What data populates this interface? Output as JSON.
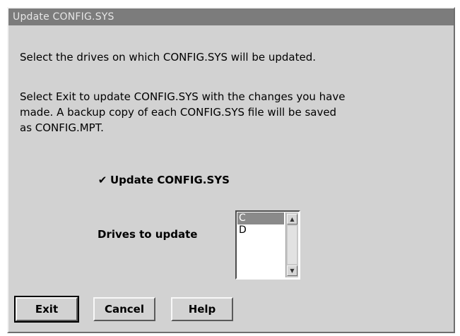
{
  "window": {
    "title": "Update CONFIG.SYS"
  },
  "body": {
    "instruction1": "Select the drives on which CONFIG.SYS will be updated.",
    "instruction2": "Select Exit to update CONFIG.SYS with the changes you have\nmade.  A backup copy of each CONFIG.SYS file will be saved\nas CONFIG.MPT."
  },
  "checkbox": {
    "label": "Update CONFIG.SYS",
    "checked": true,
    "mark": "✔"
  },
  "drives": {
    "label": "Drives to update",
    "items": [
      "C",
      "D"
    ],
    "selected": "C"
  },
  "scrollbar": {
    "up_icon": "▲",
    "down_icon": "▼"
  },
  "buttons": {
    "exit": "Exit",
    "cancel": "Cancel",
    "help": "Help"
  }
}
